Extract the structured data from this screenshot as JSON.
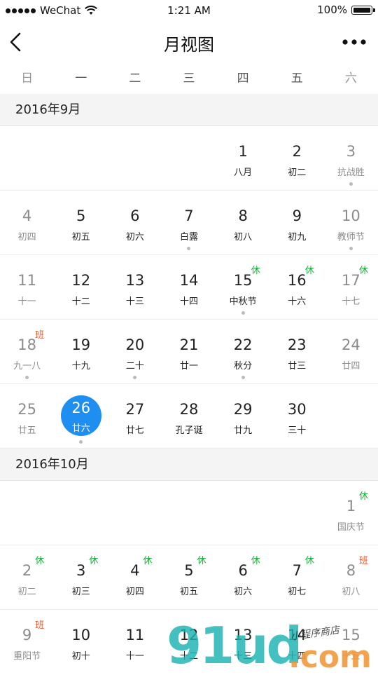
{
  "status": {
    "carrier": "WeChat",
    "time": "1:21 AM",
    "battery": "100%"
  },
  "nav": {
    "title": "月视图"
  },
  "weekdays": [
    "日",
    "一",
    "二",
    "三",
    "四",
    "五",
    "六"
  ],
  "months": [
    {
      "title": "2016年9月",
      "weeks": [
        [
          null,
          null,
          null,
          null,
          {
            "d": "1",
            "l": "八月"
          },
          {
            "d": "2",
            "l": "初二"
          },
          {
            "d": "3",
            "l": "抗战胜",
            "dot": true
          }
        ],
        [
          {
            "d": "4",
            "l": "初四"
          },
          {
            "d": "5",
            "l": "初五"
          },
          {
            "d": "6",
            "l": "初六"
          },
          {
            "d": "7",
            "l": "白露",
            "dot": true
          },
          {
            "d": "8",
            "l": "初八"
          },
          {
            "d": "9",
            "l": "初九"
          },
          {
            "d": "10",
            "l": "教师节",
            "dot": true
          }
        ],
        [
          {
            "d": "11",
            "l": "十一"
          },
          {
            "d": "12",
            "l": "十二"
          },
          {
            "d": "13",
            "l": "十三"
          },
          {
            "d": "14",
            "l": "十四"
          },
          {
            "d": "15",
            "l": "中秋节",
            "dot": true,
            "tag": "休"
          },
          {
            "d": "16",
            "l": "十六",
            "tag": "休"
          },
          {
            "d": "17",
            "l": "十七",
            "tag": "休"
          }
        ],
        [
          {
            "d": "18",
            "l": "九一八",
            "dot": true,
            "tag": "班"
          },
          {
            "d": "19",
            "l": "十九"
          },
          {
            "d": "20",
            "l": "二十",
            "dot": true
          },
          {
            "d": "21",
            "l": "廿一"
          },
          {
            "d": "22",
            "l": "秋分",
            "dot": true
          },
          {
            "d": "23",
            "l": "廿三"
          },
          {
            "d": "24",
            "l": "廿四"
          }
        ],
        [
          {
            "d": "25",
            "l": "廿五"
          },
          {
            "d": "26",
            "l": "廿六",
            "selected": true,
            "dot": true
          },
          {
            "d": "27",
            "l": "廿七"
          },
          {
            "d": "28",
            "l": "孔子诞"
          },
          {
            "d": "29",
            "l": "廿九"
          },
          {
            "d": "30",
            "l": "三十"
          },
          null
        ]
      ]
    },
    {
      "title": "2016年10月",
      "weeks": [
        [
          null,
          null,
          null,
          null,
          null,
          null,
          {
            "d": "1",
            "l": "国庆节",
            "tag": "休"
          }
        ],
        [
          {
            "d": "2",
            "l": "初二",
            "tag": "休"
          },
          {
            "d": "3",
            "l": "初三",
            "tag": "休"
          },
          {
            "d": "4",
            "l": "初四",
            "tag": "休"
          },
          {
            "d": "5",
            "l": "初五",
            "tag": "休"
          },
          {
            "d": "6",
            "l": "初六",
            "tag": "休"
          },
          {
            "d": "7",
            "l": "初七",
            "tag": "休"
          },
          {
            "d": "8",
            "l": "初八",
            "tag": "班"
          }
        ],
        [
          {
            "d": "9",
            "l": "重阳节",
            "tag": "班"
          },
          {
            "d": "10",
            "l": "初十"
          },
          {
            "d": "11",
            "l": "十一"
          },
          {
            "d": "12",
            "l": "十二"
          },
          {
            "d": "13",
            "l": "十三"
          },
          {
            "d": "14",
            "l": "十四"
          },
          {
            "d": "15",
            "l": "十五"
          }
        ]
      ]
    }
  ],
  "watermark": {
    "logo": "91ud",
    "suffix": ".com",
    "script": "小程序商店"
  },
  "colors": {
    "accent": "#1e8ff0",
    "rest": "#19ad3a",
    "work": "#f0562c"
  }
}
